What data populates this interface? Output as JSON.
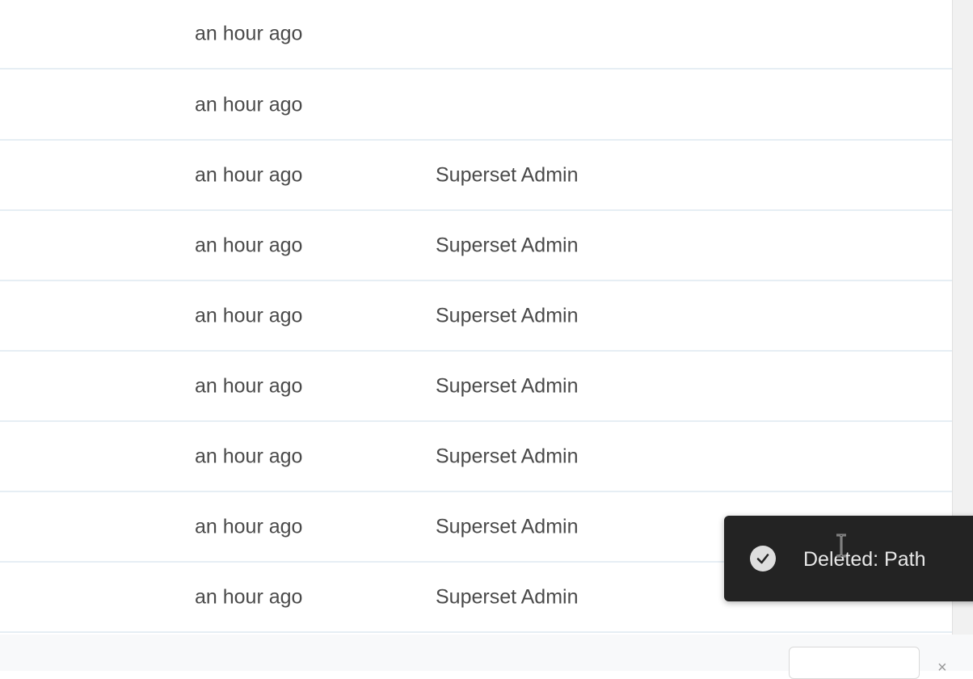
{
  "rows": [
    {
      "modified": "an hour ago",
      "owner": ""
    },
    {
      "modified": "an hour ago",
      "owner": ""
    },
    {
      "modified": "an hour ago",
      "owner": "Superset Admin"
    },
    {
      "modified": "an hour ago",
      "owner": "Superset Admin"
    },
    {
      "modified": "an hour ago",
      "owner": "Superset Admin"
    },
    {
      "modified": "an hour ago",
      "owner": "Superset Admin"
    },
    {
      "modified": "an hour ago",
      "owner": "Superset Admin"
    },
    {
      "modified": "an hour ago",
      "owner": "Superset Admin"
    },
    {
      "modified": "an hour ago",
      "owner": "Superset Admin"
    }
  ],
  "toast": {
    "message": "Deleted: Path",
    "icon": "check-circle-icon"
  },
  "colors": {
    "toast_bg": "#232323",
    "row_border": "#e6eef4",
    "accent": "#20a7c9"
  }
}
